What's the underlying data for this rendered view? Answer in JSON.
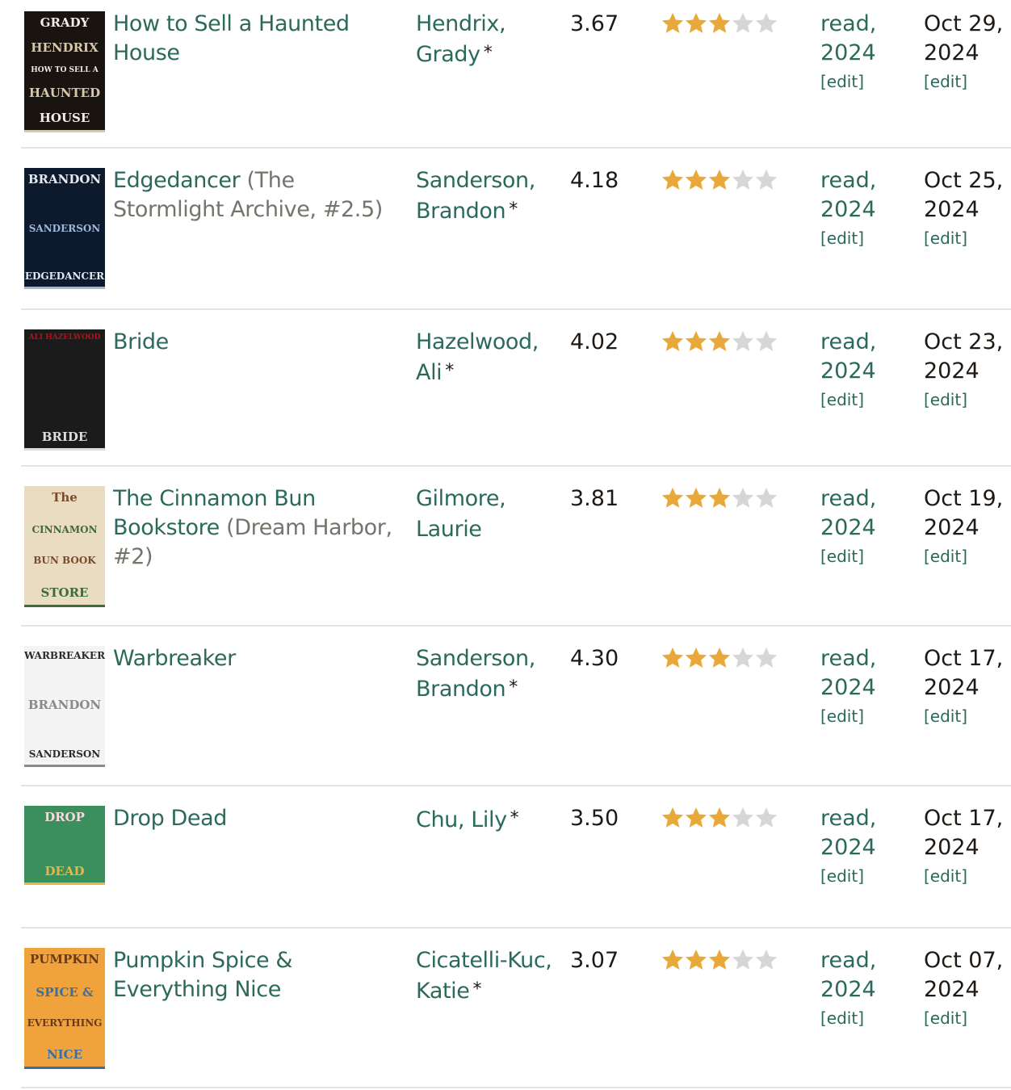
{
  "rows": [
    {
      "title": "How to Sell a Haunted House",
      "series": "",
      "author": "Hendrix, Grady",
      "author_mark": "*",
      "avg_rating": "3.67",
      "stars_filled": 3,
      "stars_total": 5,
      "shelf": "read, 2024",
      "edit_label": "[edit]",
      "date": "Oct 29, 2024",
      "date_edit_label": "[edit]",
      "cover": {
        "text": [
          "GRADY",
          "HENDRIX",
          "HOW TO SELL A",
          "HAUNTED",
          "HOUSE"
        ],
        "bg": "#1a1410",
        "fg": "#f2ede2",
        "accent": "#d7c9a8"
      }
    },
    {
      "title": "Edgedancer",
      "series": "(The Stormlight Archive, #2.5)",
      "author": "Sanderson, Brandon",
      "author_mark": "*",
      "avg_rating": "4.18",
      "stars_filled": 3,
      "stars_total": 5,
      "shelf": "read, 2024",
      "edit_label": "[edit]",
      "date": "Oct 25, 2024",
      "date_edit_label": "[edit]",
      "cover": {
        "text": [
          "BRANDON",
          "SANDERSON",
          "EDGEDANCER"
        ],
        "bg": "#0d1a2e",
        "fg": "#e6e9ef",
        "accent": "#9fb7d9"
      }
    },
    {
      "title": "Bride",
      "series": "",
      "author": "Hazelwood, Ali",
      "author_mark": "*",
      "avg_rating": "4.02",
      "stars_filled": 3,
      "stars_total": 5,
      "shelf": "read, 2024",
      "edit_label": "[edit]",
      "date": "Oct 23, 2024",
      "date_edit_label": "[edit]",
      "cover": {
        "text": [
          "ALI HAZELWOOD",
          "BRIDE"
        ],
        "bg": "#1b1b1b",
        "fg": "#b5121b",
        "accent": "#dcdcdc"
      }
    },
    {
      "title": "The Cinnamon Bun Bookstore",
      "series": "(Dream Harbor, #2)",
      "author": "Gilmore, Laurie",
      "author_mark": "",
      "avg_rating": "3.81",
      "stars_filled": 3,
      "stars_total": 5,
      "shelf": "read, 2024",
      "edit_label": "[edit]",
      "date": "Oct 19, 2024",
      "date_edit_label": "[edit]",
      "cover": {
        "text": [
          "The",
          "CINNAMON",
          "BUN BOOK",
          "STORE"
        ],
        "bg": "#e9dcc0",
        "fg": "#7a4a2a",
        "accent": "#3f6b3a"
      }
    },
    {
      "title": "Warbreaker",
      "series": "",
      "author": "Sanderson, Brandon",
      "author_mark": "*",
      "avg_rating": "4.30",
      "stars_filled": 3,
      "stars_total": 5,
      "shelf": "read, 2024",
      "edit_label": "[edit]",
      "date": "Oct 17, 2024",
      "date_edit_label": "[edit]",
      "cover": {
        "text": [
          "WARBREAKER",
          "BRANDON",
          "SANDERSON"
        ],
        "bg": "#f4f4f4",
        "fg": "#2a2a2a",
        "accent": "#8a8a8a"
      }
    },
    {
      "title": "Drop Dead",
      "series": "",
      "author": "Chu, Lily",
      "author_mark": "*",
      "avg_rating": "3.50",
      "stars_filled": 3,
      "stars_total": 5,
      "shelf": "read, 2024",
      "edit_label": "[edit]",
      "date": "Oct 17, 2024",
      "date_edit_label": "[edit]",
      "cover": {
        "text": [
          "DROP",
          "DEAD"
        ],
        "bg": "#3a8f5c",
        "fg": "#f7d9df",
        "accent": "#e7b64a"
      }
    },
    {
      "title": "Pumpkin Spice & Everything Nice",
      "series": "",
      "author": "Cicatelli-Kuc, Katie",
      "author_mark": "*",
      "avg_rating": "3.07",
      "stars_filled": 3,
      "stars_total": 5,
      "shelf": "read, 2024",
      "edit_label": "[edit]",
      "date": "Oct 07, 2024",
      "date_edit_label": "[edit]",
      "cover": {
        "text": [
          "PUMPKIN",
          "SPICE &",
          "EVERYTHING",
          "NICE"
        ],
        "bg": "#f0a23c",
        "fg": "#6b3a12",
        "accent": "#3b6fa3"
      }
    }
  ],
  "colors": {
    "link": "#2b6a5b",
    "star_on": "#e8a93a",
    "star_off": "#d6d6d6",
    "divider": "#e5e3de"
  }
}
